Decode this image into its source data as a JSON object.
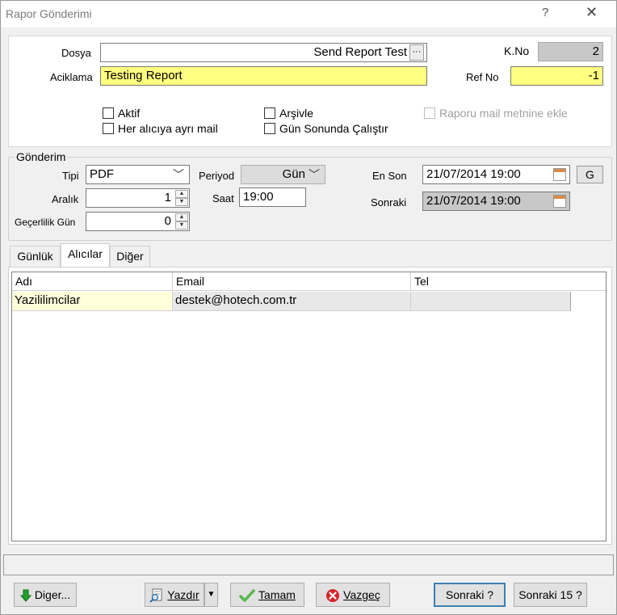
{
  "window": {
    "title": "Rapor Gönderimi",
    "help": "?",
    "close": "✕"
  },
  "form": {
    "dosya_label": "Dosya",
    "dosya_value": "Send Report Test",
    "dosya_browse": "···",
    "aciklama_label": "Aciklama",
    "aciklama_value": "Testing Report",
    "kno_label": "K.No",
    "kno_value": "2",
    "refno_label": "Ref No",
    "refno_value": "-1",
    "checkboxes": {
      "aktif": "Aktif",
      "her_aliciya": "Her alıcıya ayrı mail",
      "arsivle": "Arşivle",
      "gun_sonunda": "Gün Sonunda Çalıştır",
      "raporu_mail": "Raporu mail metnine ekle"
    }
  },
  "gonderim": {
    "legend": "Gönderim",
    "tipi_label": "Tipi",
    "tipi_value": "PDF",
    "aralik_label": "Aralık",
    "aralik_value": "1",
    "gecerlilik_label": "Geçerlilik Gün",
    "gecerlilik_value": "0",
    "periyod_label": "Periyod",
    "periyod_value": "Gün",
    "saat_label": "Saat",
    "saat_value": "19:00",
    "enson_label": "En Son",
    "enson_value": "21/07/2014 19:00",
    "g_button": "G",
    "sonraki_label": "Sonraki",
    "sonraki_value": "21/07/2014 19:00"
  },
  "tabs": [
    {
      "label": "Günlük"
    },
    {
      "label": "Alıcılar"
    },
    {
      "label": "Diğer"
    }
  ],
  "grid": {
    "columns": [
      "Adı",
      "Email",
      "Tel"
    ],
    "rows": [
      {
        "adi": "Yazililimcilar",
        "email": "destek@hotech.com.tr",
        "tel": ""
      }
    ]
  },
  "buttons": {
    "diger": "Diger...",
    "yazdir": "Yazdır",
    "tamam": "Tamam",
    "vazgec": "Vazgeç",
    "sonraki": "Sonraki ?",
    "sonraki15": "Sonraki 15 ?"
  },
  "icons": {
    "diger": "arrow-down-icon",
    "yazdir": "print-preview-icon",
    "tamam": "check-icon",
    "vazgec": "cancel-icon"
  }
}
